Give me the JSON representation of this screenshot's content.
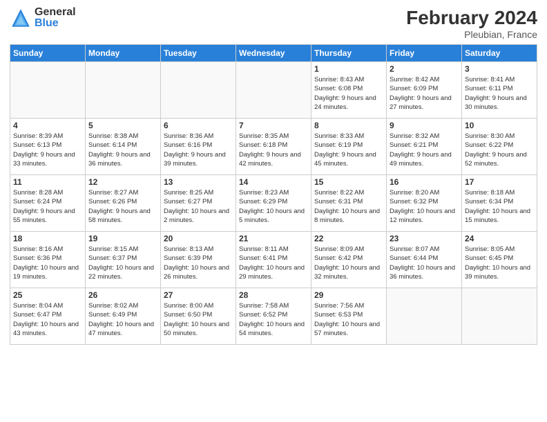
{
  "logo": {
    "general": "General",
    "blue": "Blue"
  },
  "header": {
    "month": "February 2024",
    "location": "Pleubian, France"
  },
  "days_of_week": [
    "Sunday",
    "Monday",
    "Tuesday",
    "Wednesday",
    "Thursday",
    "Friday",
    "Saturday"
  ],
  "weeks": [
    [
      {
        "day": "",
        "info": ""
      },
      {
        "day": "",
        "info": ""
      },
      {
        "day": "",
        "info": ""
      },
      {
        "day": "",
        "info": ""
      },
      {
        "day": "1",
        "info": "Sunrise: 8:43 AM\nSunset: 6:08 PM\nDaylight: 9 hours and 24 minutes."
      },
      {
        "day": "2",
        "info": "Sunrise: 8:42 AM\nSunset: 6:09 PM\nDaylight: 9 hours and 27 minutes."
      },
      {
        "day": "3",
        "info": "Sunrise: 8:41 AM\nSunset: 6:11 PM\nDaylight: 9 hours and 30 minutes."
      }
    ],
    [
      {
        "day": "4",
        "info": "Sunrise: 8:39 AM\nSunset: 6:13 PM\nDaylight: 9 hours and 33 minutes."
      },
      {
        "day": "5",
        "info": "Sunrise: 8:38 AM\nSunset: 6:14 PM\nDaylight: 9 hours and 36 minutes."
      },
      {
        "day": "6",
        "info": "Sunrise: 8:36 AM\nSunset: 6:16 PM\nDaylight: 9 hours and 39 minutes."
      },
      {
        "day": "7",
        "info": "Sunrise: 8:35 AM\nSunset: 6:18 PM\nDaylight: 9 hours and 42 minutes."
      },
      {
        "day": "8",
        "info": "Sunrise: 8:33 AM\nSunset: 6:19 PM\nDaylight: 9 hours and 45 minutes."
      },
      {
        "day": "9",
        "info": "Sunrise: 8:32 AM\nSunset: 6:21 PM\nDaylight: 9 hours and 49 minutes."
      },
      {
        "day": "10",
        "info": "Sunrise: 8:30 AM\nSunset: 6:22 PM\nDaylight: 9 hours and 52 minutes."
      }
    ],
    [
      {
        "day": "11",
        "info": "Sunrise: 8:28 AM\nSunset: 6:24 PM\nDaylight: 9 hours and 55 minutes."
      },
      {
        "day": "12",
        "info": "Sunrise: 8:27 AM\nSunset: 6:26 PM\nDaylight: 9 hours and 58 minutes."
      },
      {
        "day": "13",
        "info": "Sunrise: 8:25 AM\nSunset: 6:27 PM\nDaylight: 10 hours and 2 minutes."
      },
      {
        "day": "14",
        "info": "Sunrise: 8:23 AM\nSunset: 6:29 PM\nDaylight: 10 hours and 5 minutes."
      },
      {
        "day": "15",
        "info": "Sunrise: 8:22 AM\nSunset: 6:31 PM\nDaylight: 10 hours and 8 minutes."
      },
      {
        "day": "16",
        "info": "Sunrise: 8:20 AM\nSunset: 6:32 PM\nDaylight: 10 hours and 12 minutes."
      },
      {
        "day": "17",
        "info": "Sunrise: 8:18 AM\nSunset: 6:34 PM\nDaylight: 10 hours and 15 minutes."
      }
    ],
    [
      {
        "day": "18",
        "info": "Sunrise: 8:16 AM\nSunset: 6:36 PM\nDaylight: 10 hours and 19 minutes."
      },
      {
        "day": "19",
        "info": "Sunrise: 8:15 AM\nSunset: 6:37 PM\nDaylight: 10 hours and 22 minutes."
      },
      {
        "day": "20",
        "info": "Sunrise: 8:13 AM\nSunset: 6:39 PM\nDaylight: 10 hours and 26 minutes."
      },
      {
        "day": "21",
        "info": "Sunrise: 8:11 AM\nSunset: 6:41 PM\nDaylight: 10 hours and 29 minutes."
      },
      {
        "day": "22",
        "info": "Sunrise: 8:09 AM\nSunset: 6:42 PM\nDaylight: 10 hours and 32 minutes."
      },
      {
        "day": "23",
        "info": "Sunrise: 8:07 AM\nSunset: 6:44 PM\nDaylight: 10 hours and 36 minutes."
      },
      {
        "day": "24",
        "info": "Sunrise: 8:05 AM\nSunset: 6:45 PM\nDaylight: 10 hours and 39 minutes."
      }
    ],
    [
      {
        "day": "25",
        "info": "Sunrise: 8:04 AM\nSunset: 6:47 PM\nDaylight: 10 hours and 43 minutes."
      },
      {
        "day": "26",
        "info": "Sunrise: 8:02 AM\nSunset: 6:49 PM\nDaylight: 10 hours and 47 minutes."
      },
      {
        "day": "27",
        "info": "Sunrise: 8:00 AM\nSunset: 6:50 PM\nDaylight: 10 hours and 50 minutes."
      },
      {
        "day": "28",
        "info": "Sunrise: 7:58 AM\nSunset: 6:52 PM\nDaylight: 10 hours and 54 minutes."
      },
      {
        "day": "29",
        "info": "Sunrise: 7:56 AM\nSunset: 6:53 PM\nDaylight: 10 hours and 57 minutes."
      },
      {
        "day": "",
        "info": ""
      },
      {
        "day": "",
        "info": ""
      }
    ]
  ]
}
